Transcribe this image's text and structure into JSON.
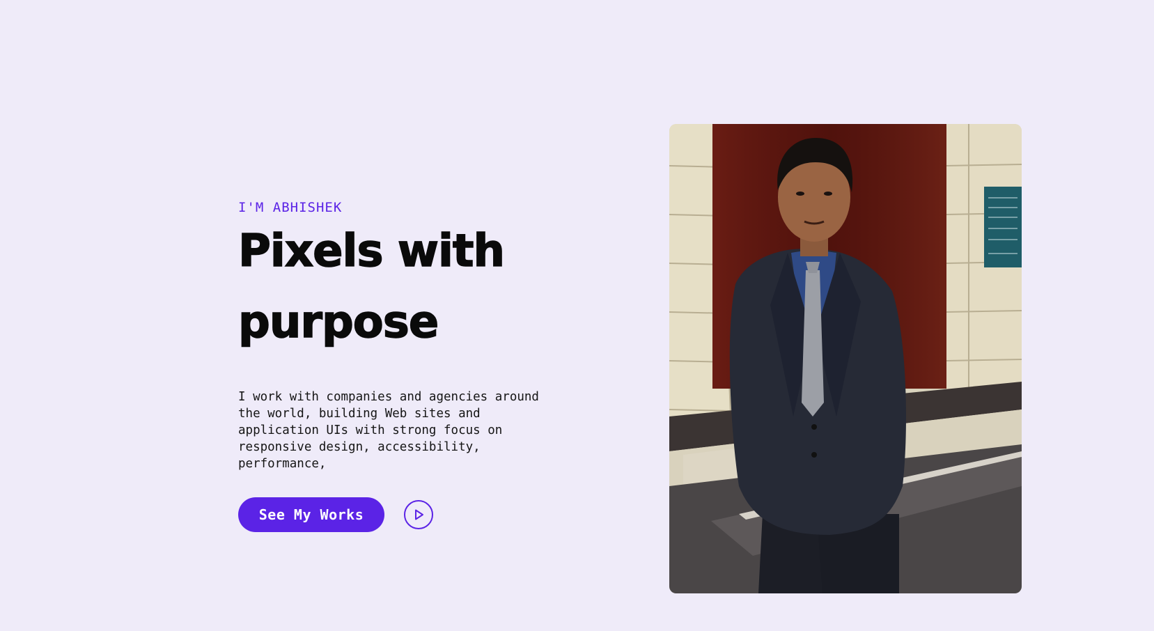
{
  "hero": {
    "eyebrow": "I'M ABHISHEK",
    "headline_line1": "Pixels with",
    "headline_line2": "purpose",
    "description": "I work with companies and agencies around the world, building Web sites and application UIs with strong focus on responsive design, accessibility, performance,",
    "cta_label": "See My Works",
    "play_icon": "play-circle-icon"
  },
  "portrait": {
    "alt": "portrait photo"
  },
  "colors": {
    "background": "#efebf9",
    "accent": "#5b23e6",
    "text": "#0a0a0a"
  }
}
